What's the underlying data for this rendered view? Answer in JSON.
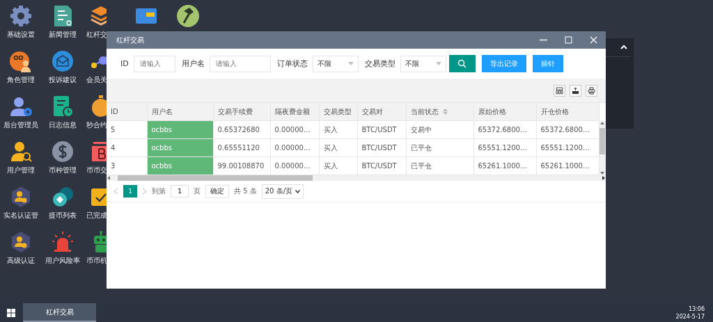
{
  "desktop_columns": [
    {
      "apps": [
        {
          "label": "基础设置"
        },
        {
          "label": "角色管理"
        },
        {
          "label": "后台管理员"
        },
        {
          "label": "用户管理"
        },
        {
          "label": "实名认证管"
        },
        {
          "label": "高级认证"
        }
      ]
    },
    {
      "apps": [
        {
          "label": "新闻管理"
        },
        {
          "label": "投诉建议"
        },
        {
          "label": "日志信息"
        },
        {
          "label": "币种管理"
        },
        {
          "label": "提币列表"
        },
        {
          "label": "用户风险率"
        }
      ]
    },
    {
      "apps": [
        {
          "label": "杠杆交"
        },
        {
          "label": "会员关"
        },
        {
          "label": "秒合约"
        },
        {
          "label": "币币交"
        },
        {
          "label": "已完成"
        },
        {
          "label": "币币机"
        }
      ]
    }
  ],
  "window": {
    "title": "杠杆交易",
    "filters": [
      {
        "kind": "input",
        "label": "ID",
        "placeholder": "请输入"
      },
      {
        "kind": "input",
        "label": "用户名",
        "placeholder": "请输入"
      },
      {
        "kind": "select",
        "label": "订单状态",
        "value": "不限"
      },
      {
        "kind": "select",
        "label": "交易类型",
        "value": "不限"
      }
    ],
    "buttons": [
      {
        "kind": "search"
      },
      {
        "kind": "text",
        "label": "导出记录"
      },
      {
        "kind": "text",
        "label": "插针"
      }
    ],
    "table": {
      "columns": [
        {
          "label": "ID"
        },
        {
          "label": "用户名"
        },
        {
          "label": "交易手续费"
        },
        {
          "label": "隔夜费金额"
        },
        {
          "label": "交易类型"
        },
        {
          "label": "交易对"
        },
        {
          "label": "当前状态",
          "sortable": true
        },
        {
          "label": "原始价格"
        },
        {
          "label": "开仓价格"
        }
      ],
      "rows": [
        [
          "5",
          "ocbbs",
          "0.65372680",
          "0.00000…",
          "买入",
          "BTC/USDT",
          "交易中",
          "65372.6800…",
          "65372.6800…"
        ],
        [
          "4",
          "ocbbs",
          "0.65551120",
          "0.00000…",
          "买入",
          "BTC/USDT",
          "已平仓",
          "65551.1200…",
          "65551.1200…"
        ],
        [
          "3",
          "ocbbs",
          "99.00108870",
          "0.00000…",
          "买入",
          "BTC/USDT",
          "已平仓",
          "65261.1000…",
          "65261.1000…"
        ]
      ]
    },
    "pagination": {
      "pages": [
        {
          "label": "1",
          "selected": true
        }
      ],
      "goto_label": "到第",
      "goto_value": "1",
      "page_unit": "页",
      "confirm": "确定",
      "total": "共 5 条",
      "page_size": "20 条/页"
    }
  },
  "taskbar": {
    "tasks": [
      {
        "label": "杠杆交易",
        "selected": true
      }
    ],
    "time": "13:06",
    "date": "2024-5-17"
  }
}
